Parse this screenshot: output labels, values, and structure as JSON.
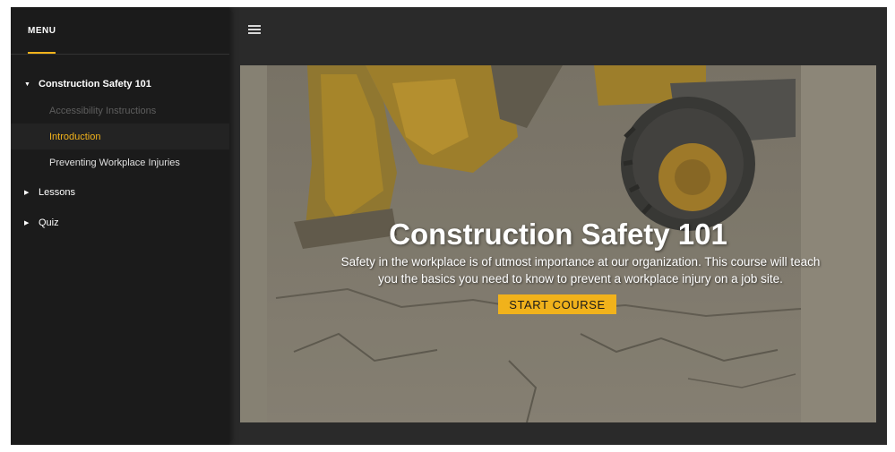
{
  "sidebar": {
    "menu_title": "MENU",
    "sections": [
      {
        "label": "Construction Safety 101",
        "expanded": true,
        "items": [
          {
            "label": "Accessibility Instructions",
            "state": "disabled"
          },
          {
            "label": "Introduction",
            "state": "current"
          },
          {
            "label": "Preventing Workplace Injuries",
            "state": "normal"
          }
        ]
      },
      {
        "label": "Lessons",
        "expanded": false
      },
      {
        "label": "Quiz",
        "expanded": false
      }
    ]
  },
  "topbar": {
    "menu_icon": "hamburger-icon"
  },
  "hero": {
    "title": "Construction Safety 101",
    "description": "Safety in the workplace is of utmost importance at our organization. This course will teach you the basics you need to know to prevent a workplace injury on a job site.",
    "button_label": "START COURSE"
  },
  "colors": {
    "accent": "#f1b21b",
    "sidebar_bg": "#1b1b1b",
    "main_bg": "#2a2a2a"
  }
}
